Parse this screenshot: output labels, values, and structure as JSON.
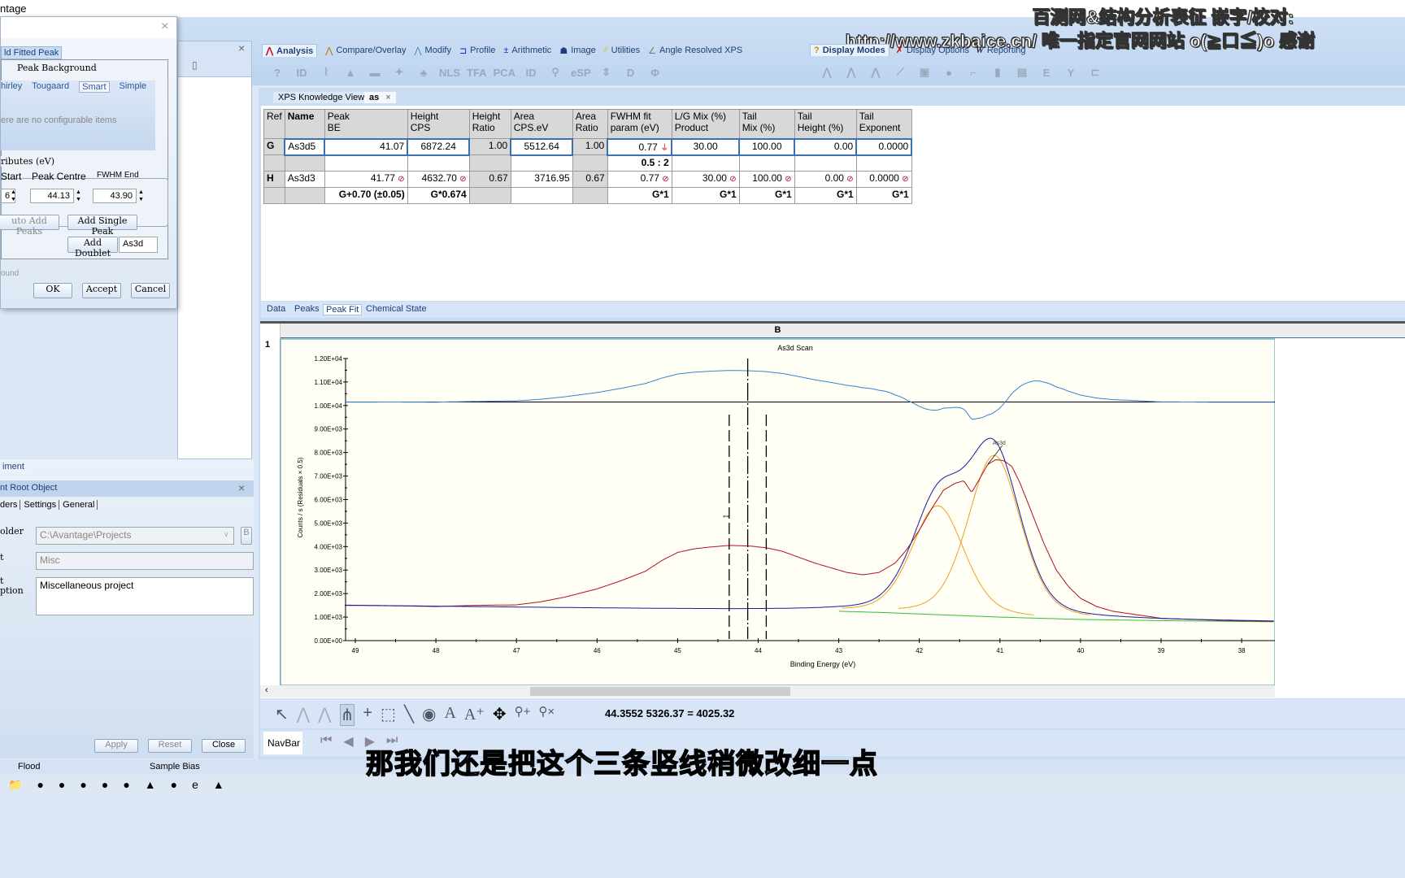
{
  "window": {
    "title": "ntage"
  },
  "watermark": {
    "line1": "百测网&结构分析表征 嵌字/校对:",
    "line2": "http://www.zkbaice.cn/  唯一指定官网网站  o(≧口≦)o 感谢"
  },
  "ribbon": {
    "tabs": [
      {
        "label": "Analysis",
        "icon": "analysis-peak-icon"
      },
      {
        "label": "Compare/Overlay",
        "icon": "overlay-icon"
      },
      {
        "label": "Modify",
        "icon": "modify-icon"
      },
      {
        "label": "Profile",
        "icon": "profile-icon"
      },
      {
        "label": "Arithmetic",
        "icon": "arithmetic-icon"
      },
      {
        "label": "Image",
        "icon": "image-icon"
      },
      {
        "label": "Utilities",
        "icon": "utilities-icon"
      },
      {
        "label": "Angle Resolved XPS",
        "icon": "angle-icon"
      }
    ],
    "right_tabs": [
      {
        "label": "Display Modes"
      },
      {
        "label": "Display Options"
      },
      {
        "label": "Reporting"
      }
    ],
    "tools": [
      "?",
      "ID",
      "⌇",
      "▲",
      "▬",
      "✦",
      "♣",
      "NLS",
      "TFA",
      "PCA",
      "ID",
      "⚲",
      "eSP",
      "⇕",
      "D",
      "Φ"
    ],
    "display_tools": [
      "⋀",
      "⋀",
      "⋀",
      "⟋",
      "▣",
      "●",
      "⌐",
      "▮",
      "▤",
      "E",
      "Y",
      "⊏"
    ]
  },
  "dialog": {
    "tab": "ld Fitted Peak",
    "bg_label": "Peak Background",
    "bg_tabs": [
      "hirley",
      "Tougaard",
      "Smart",
      "Simple"
    ],
    "bg_selected": "Smart",
    "no_items": "ere are no configurable items",
    "attr_label": "ributes (eV)",
    "col_start": "Start",
    "col_centre": "Peak Centre",
    "col_end": "FWHM End",
    "start": "6",
    "centre": "44.13",
    "end": "43.90",
    "auto_add": "uto Add Peaks",
    "add_single": "Add Single Peak",
    "add_doublet": "Add Doublet",
    "doublet_value": "As3d",
    "footer": "ound",
    "ok": "OK",
    "accept": "Accept",
    "cancel": "Cancel"
  },
  "doc_tabs": [
    {
      "label": "XPS Knowledge View"
    },
    {
      "label": "as"
    }
  ],
  "peak_table": {
    "headers": [
      [
        "Ref",
        ""
      ],
      [
        "Name",
        ""
      ],
      [
        "Peak",
        "BE"
      ],
      [
        "Height",
        "CPS"
      ],
      [
        "Height",
        "Ratio"
      ],
      [
        "Area",
        "CPS.eV"
      ],
      [
        "Area",
        "Ratio"
      ],
      [
        "FWHM fit",
        "param (eV)"
      ],
      [
        "L/G Mix (%)",
        "Product"
      ],
      [
        "Tail",
        "Mix (%)"
      ],
      [
        "Tail",
        "Height (%)"
      ],
      [
        "Tail",
        "Exponent"
      ]
    ],
    "rows": [
      [
        "G",
        "As3d5",
        "41.07",
        "6872.24",
        "1.00",
        "5512.64",
        "1.00",
        "0.77",
        "30.00",
        "100.00",
        "0.00",
        "0.0000"
      ],
      [
        "",
        "",
        "",
        "",
        "",
        "",
        "",
        "0.5 : 2",
        "",
        "",
        "",
        ""
      ],
      [
        "H",
        "As3d3",
        "41.77",
        "4632.70",
        "0.67",
        "3716.95",
        "0.67",
        "0.77",
        "30.00",
        "100.00",
        "0.00",
        "0.0000"
      ],
      [
        "",
        "",
        "G+0.70 (±0.05)",
        "G*0.674",
        "",
        "",
        "",
        "G*1",
        "G*1",
        "G*1",
        "G*1",
        "G*1"
      ]
    ]
  },
  "view_tabs": [
    "Data",
    "Peaks",
    "Peak Fit",
    "Chemical State"
  ],
  "view_tab_selected": "Peak Fit",
  "chart_grid": {
    "column": "B",
    "row": "1"
  },
  "chart_data": {
    "type": "line",
    "title": "As3d Scan",
    "xlabel": "Binding Energy (eV)",
    "ylabel": "Counts / s  (Residuals × 0.5)",
    "xlim": [
      49.12,
      37.59
    ],
    "ylim": [
      0,
      12000
    ],
    "x_reversed": true,
    "yticks": [
      "0.00E+00",
      "1.00E+03",
      "2.00E+03",
      "3.00E+03",
      "4.00E+03",
      "5.00E+03",
      "6.00E+03",
      "7.00E+03",
      "8.00E+03",
      "9.00E+03",
      "1.00E+04",
      "1.10E+04",
      "1.20E+04"
    ],
    "xticks": [
      49,
      48,
      47,
      46,
      45,
      44,
      43,
      42,
      41,
      40,
      39,
      38
    ],
    "residual_baseline": 10150,
    "residual_scale": 0.5,
    "data": {
      "x": [
        49.12,
        48.5,
        48,
        47.5,
        47,
        46.7,
        46.4,
        46,
        45.7,
        45.4,
        45.2,
        45,
        44.8,
        44.6,
        44.35,
        44.1,
        43.9,
        43.7,
        43.5,
        43.3,
        43.1,
        42.9,
        42.7,
        42.5,
        42.3,
        42.15,
        42,
        41.85,
        41.7,
        41.55,
        41.45,
        41.35,
        41.25,
        41.15,
        41.05,
        40.95,
        40.85,
        40.75,
        40.6,
        40.45,
        40.3,
        40.15,
        40,
        39.8,
        39.6,
        39.3,
        39,
        38.6,
        38.2,
        37.59
      ],
      "y": [
        1500,
        1480,
        1450,
        1500,
        1520,
        1650,
        1850,
        2200,
        2550,
        2950,
        3400,
        3750,
        3900,
        3980,
        4050,
        4020,
        3950,
        3800,
        3550,
        3300,
        3100,
        2900,
        2800,
        2900,
        3300,
        3900,
        4700,
        5600,
        6400,
        6700,
        6800,
        6300,
        6900,
        7500,
        7700,
        7650,
        7400,
        6700,
        5400,
        4100,
        3000,
        2300,
        1800,
        1450,
        1250,
        1100,
        950,
        900,
        850,
        820
      ]
    },
    "background": {
      "x": [
        49.12,
        43,
        42.5,
        41,
        40,
        39,
        37.59
      ],
      "y": [
        1500,
        1250,
        1200,
        1000,
        900,
        850,
        800
      ]
    },
    "peaks": [
      {
        "name": "As3d5",
        "center": 41.07,
        "height": 6872.24,
        "fwhm": 0.77
      },
      {
        "name": "As3d3",
        "center": 41.77,
        "height": 4632.7,
        "fwhm": 0.77
      }
    ],
    "peak_label": "As3d",
    "markers": {
      "start": 44.36,
      "centre": 44.13,
      "end": 43.9
    },
    "colors": {
      "data": "#b01020",
      "envelope": "#1a1aa0",
      "components": "#f0a020",
      "background": "#30c030",
      "residual": "#3a80d0"
    }
  },
  "cursor_readout": "44.3552  5326.37  = 4025.32",
  "navbar": {
    "label": "NavBar"
  },
  "bottom_tools": [
    "↖",
    "⋀",
    "⋀",
    "⋔",
    "+",
    "⬚",
    "╲",
    "◉",
    "A",
    "A⁺",
    "✥",
    "⚲+",
    "⚲×"
  ],
  "left_panel": {
    "tab": "iment",
    "title": "nt Root Object",
    "tabs": [
      "ders",
      "Settings",
      "General"
    ],
    "folder_label": "older",
    "folder_value": "C:\\Avantage\\Projects",
    "project_label": "t",
    "project_value": "Misc",
    "desc_label": "t\nption",
    "desc_value": "Miscellaneous project",
    "apply": "Apply",
    "reset": "Reset",
    "close": "Close",
    "browse": "B"
  },
  "status": {
    "flood": "Flood",
    "sample_bias": "Sample Bias"
  },
  "subtitle": "那我们还是把这个三条竖线稍微改细一点"
}
